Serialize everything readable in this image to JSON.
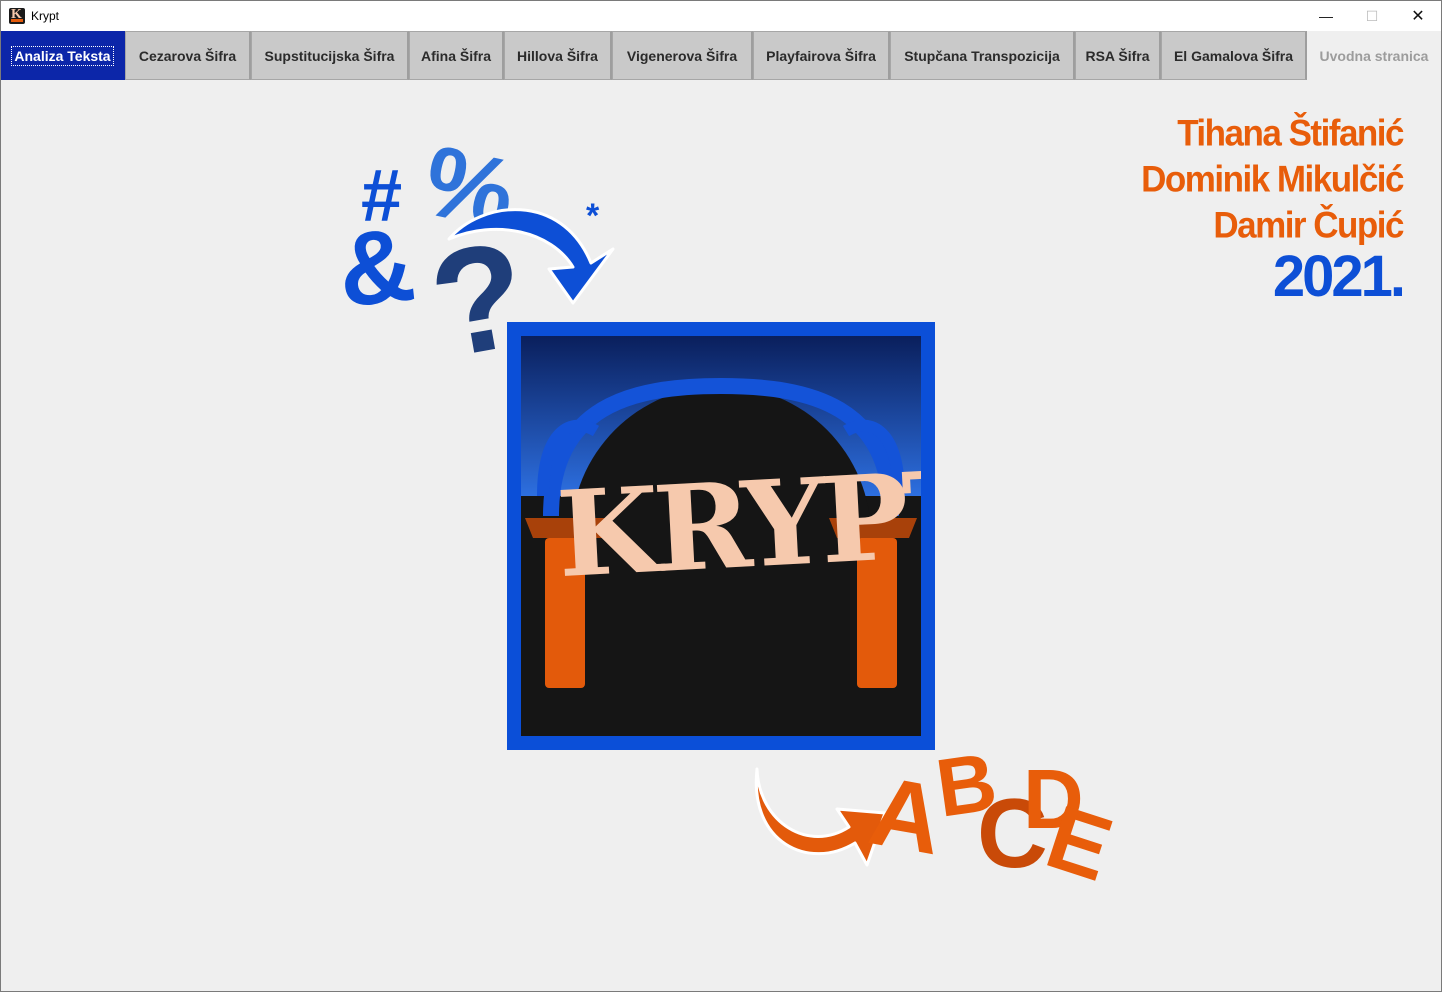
{
  "window": {
    "title": "Krypt",
    "app_icon_letter": "K"
  },
  "controls": {
    "minimize": "—",
    "maximize": "☐",
    "close": "✕"
  },
  "tabs": [
    {
      "label": "Analiza Teksta",
      "selected": true
    },
    {
      "label": "Cezarova Šifra"
    },
    {
      "label": "Supstitucijska Šifra"
    },
    {
      "label": "Afina Šifra"
    },
    {
      "label": "Hillova Šifra"
    },
    {
      "label": "Vigenerova Šifra"
    },
    {
      "label": "Playfairova Šifra"
    },
    {
      "label": "Stupčana Transpozicija"
    },
    {
      "label": "RSA Šifra"
    },
    {
      "label": "El Gamalova Šifra"
    },
    {
      "label": "Uvodna stranica",
      "muted": true
    }
  ],
  "credits": {
    "names": [
      "Tihana Štifanić",
      "Dominik Mikulčić",
      "Damir Čupić"
    ],
    "year": "2021."
  },
  "logo": {
    "text": "KRYPT"
  },
  "decor": {
    "symbols": [
      "#",
      "%",
      "*",
      "&",
      "?"
    ],
    "letters": [
      "A",
      "B",
      "C",
      "D",
      "E"
    ]
  },
  "colors": {
    "accent_blue": "#0d4fd6",
    "accent_orange": "#e85d0a",
    "selected_tab": "#0c26a9",
    "logo_text": "#f6c9ad"
  }
}
